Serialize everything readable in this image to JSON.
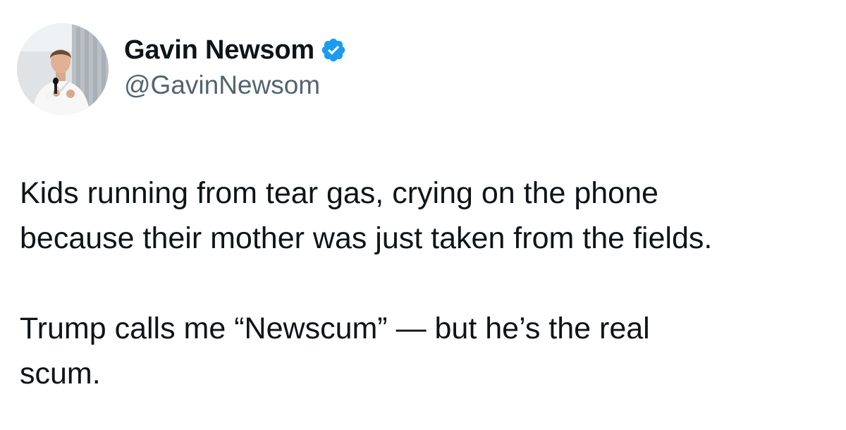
{
  "author": {
    "display_name": "Gavin Newsom",
    "handle": "@GavinNewsom",
    "verified": true,
    "verified_color": "#1d9bf0",
    "avatar_icon": "profile-photo"
  },
  "tweet": {
    "paragraphs": [
      "Kids running from tear gas, crying on the phone\nbecause their mother was just taken from the fields.",
      "Trump calls me “Newscum” — but he’s the real\nscum."
    ]
  }
}
